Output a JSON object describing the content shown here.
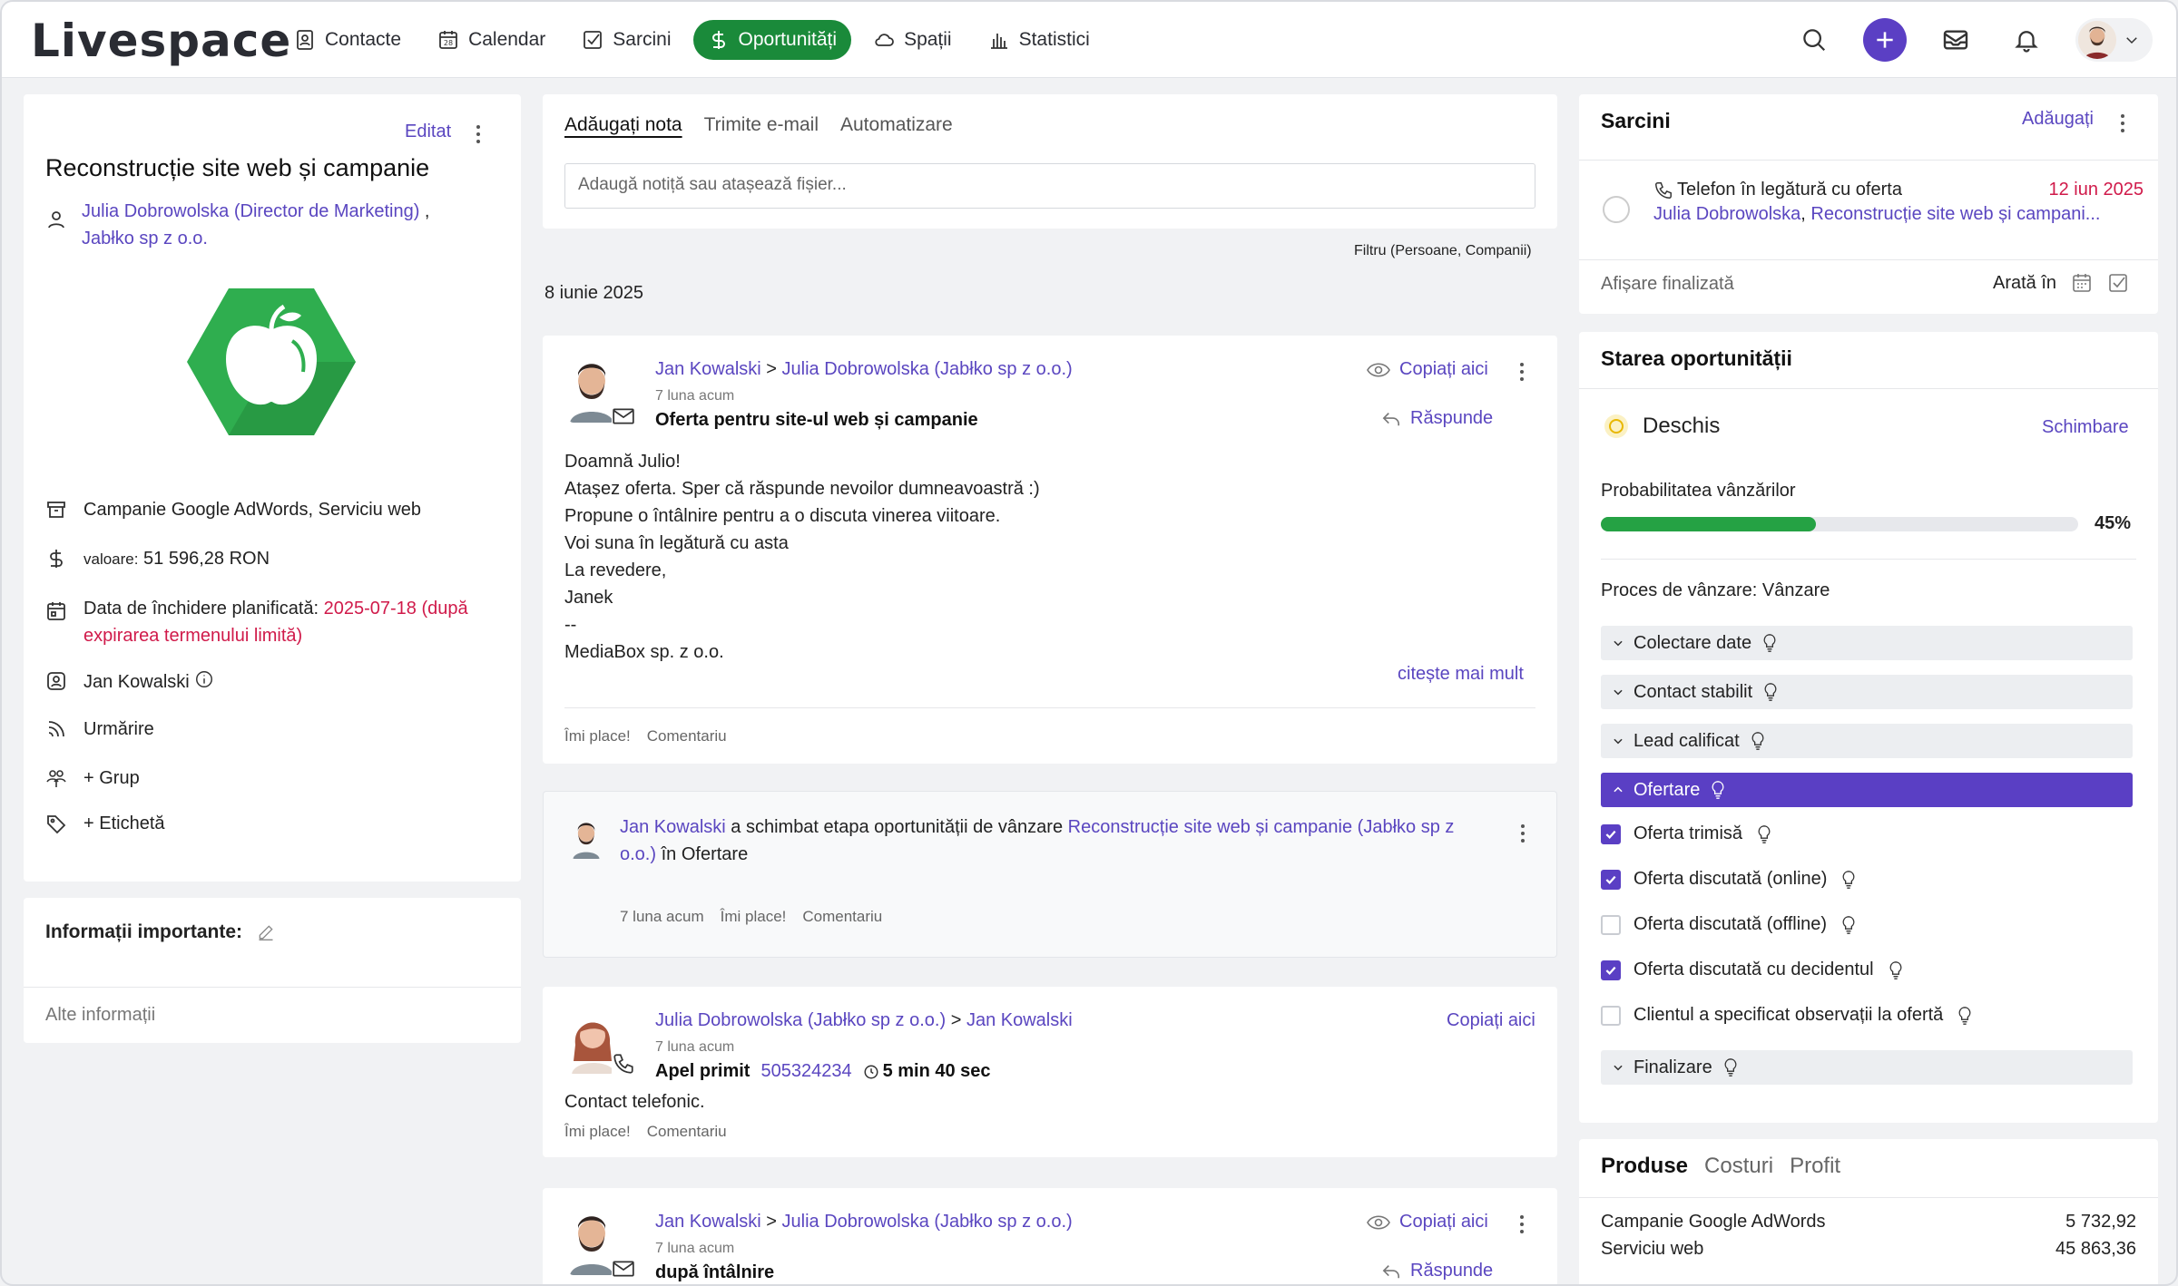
{
  "nav": {
    "logo": "Livespace",
    "items": [
      {
        "label": "Contacte",
        "icon": "contact-icon"
      },
      {
        "label": "Calendar",
        "icon": "calendar-icon"
      },
      {
        "label": "Sarcini",
        "icon": "task-icon"
      },
      {
        "label": "Oportunități",
        "icon": "dollar-icon",
        "active": true
      },
      {
        "label": "Spații",
        "icon": "cloud-icon"
      },
      {
        "label": "Statistici",
        "icon": "stats-icon"
      }
    ],
    "calendar_day": "28"
  },
  "deal": {
    "edit_label": "Editat",
    "title": "Reconstrucție site web și campanie",
    "contact": "Julia Dobrowolska (Director de Marketing)",
    "company": "Jabłko sp z o.o.",
    "products": "Campanie Google AdWords, Serviciu web",
    "value_label": "valoare:",
    "value": "51 596,28 RON",
    "close_label": "Data de închidere planificată:",
    "close_value": "2025-07-18 (după expirarea termenului limită)",
    "owner": "Jan Kowalski",
    "follow": "Urmărire",
    "group": "+ Grup",
    "tag": "+ Etichetă"
  },
  "important": {
    "title": "Informații importante:",
    "other": "Alte informații"
  },
  "compose": {
    "tabs": [
      "Adăugați nota",
      "Trimite e-mail",
      "Automatizare"
    ],
    "placeholder": "Adaugă notiță sau atașează fișier...",
    "filter": "Filtru (Persoane, Companii)",
    "date": "8 iunie 2025"
  },
  "feed": [
    {
      "from": "Jan Kowalski",
      "sep": ">",
      "to": "Julia Dobrowolska (Jabłko sp z o.o.)",
      "time": "7 luna acum",
      "subject": "Oferta pentru site-ul web și campanie",
      "copy": "Copiați aici",
      "reply": "Răspunde",
      "lines": [
        "Doamnă Julio!",
        "Atașez oferta. Sper că răspunde nevoilor dumneavoastră :)",
        "Propune o întâlnire pentru a o discuta vinerea viitoare.",
        "Voi suna în legătură cu asta",
        "La revedere,",
        "Janek",
        "--",
        "MediaBox sp. z o.o."
      ],
      "more": "citește mai mult",
      "like": "Îmi place!",
      "comment": "Comentariu"
    },
    {
      "actor": "Jan Kowalski",
      "text1": "a schimbat etapa oportunității de vânzare",
      "deal": "Reconstrucție site web și campanie (Jabłko sp z o.o.)",
      "text2": "în Ofertare",
      "time": "7 luna acum",
      "like": "Îmi place!",
      "comment": "Comentariu"
    },
    {
      "from": "Julia Dobrowolska (Jabłko sp z o.o.)",
      "sep": ">",
      "to": "Jan Kowalski",
      "time": "7 luna acum",
      "call": "Apel primit",
      "phone": "505324234",
      "duration": "5 min 40 sec",
      "copy": "Copiați aici",
      "body": "Contact telefonic.",
      "like": "Îmi place!",
      "comment": "Comentariu"
    },
    {
      "from": "Jan Kowalski",
      "sep": ">",
      "to": "Julia Dobrowolska (Jabłko sp z o.o.)",
      "time": "7 luna acum",
      "subject": "după întâlnire",
      "copy": "Copiați aici",
      "reply": "Răspunde"
    }
  ],
  "tasks": {
    "title": "Sarcini",
    "add": "Adăugați",
    "item": {
      "title": "Telefon în legătură cu oferta",
      "date": "12 iun 2025",
      "person": "Julia Dobrowolska",
      "deal": "Reconstrucție site web și campani..."
    },
    "show_done": "Afișare finalizată",
    "show_in": "Arată în"
  },
  "status": {
    "title": "Starea oportunității",
    "state": "Deschis",
    "change": "Schimbare",
    "prob_label": "Probabilitatea vânzărilor",
    "prob": "45%",
    "prob_value": 0.45,
    "process": "Proces de vânzare: Vânzare",
    "stages": [
      "Colectare date",
      "Contact stabilit",
      "Lead calificat",
      "Ofertare"
    ],
    "checks": [
      {
        "label": "Oferta trimisă",
        "checked": true
      },
      {
        "label": "Oferta discutată (online)",
        "checked": true
      },
      {
        "label": "Oferta discutată (offline)",
        "checked": false
      },
      {
        "label": "Oferta discutată cu decidentul",
        "checked": true
      },
      {
        "label": "Clientul a specificat observații la ofertă",
        "checked": false
      }
    ],
    "final_stage": "Finalizare",
    "colors": {
      "green": "#25a244",
      "purple": "#5a3fc4",
      "accent_green": "#1a8a3a"
    }
  },
  "products": {
    "tabs": [
      "Produse",
      "Costuri",
      "Profit"
    ],
    "rows": [
      {
        "name": "Campanie Google AdWords",
        "value": "5 732,92"
      },
      {
        "name": "Serviciu web",
        "value": "45 863,36"
      }
    ]
  }
}
